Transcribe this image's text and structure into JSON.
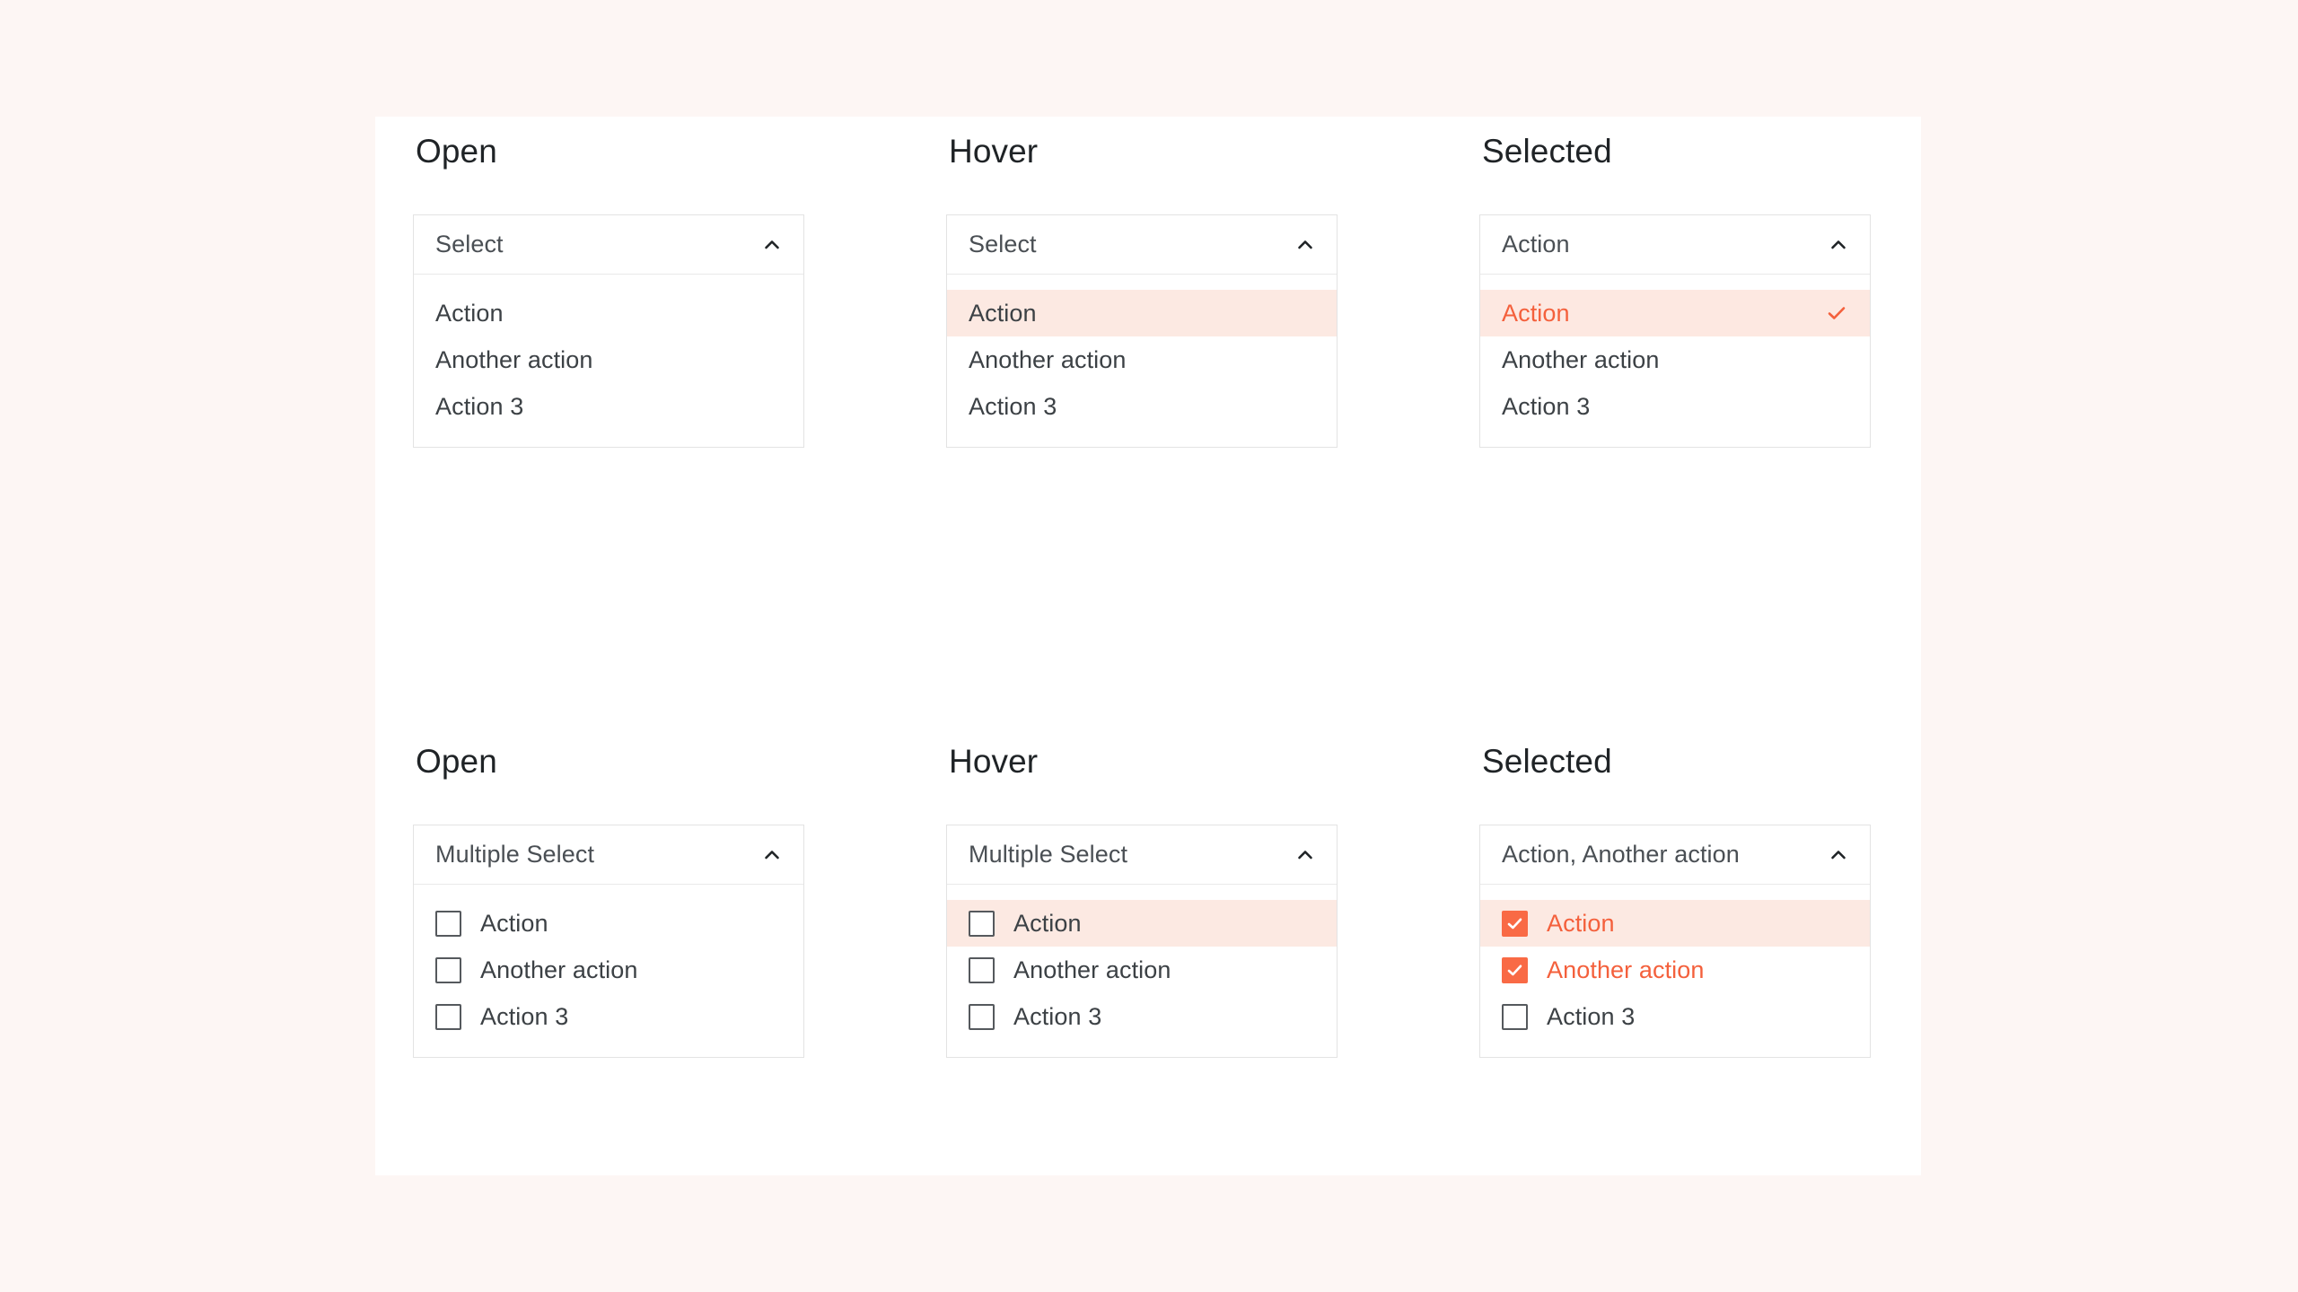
{
  "theme": {
    "page_background": "#FDF6F4",
    "card_background": "#FFFFFF",
    "accent": "#F4603C",
    "accent_checkbox": "#F96A45",
    "highlight_background": "#FCE9E2",
    "selected_background": "#FDE8E1",
    "border": "#E3E3E3",
    "text": "#3C4145",
    "title_text": "#1F2326"
  },
  "icons": {
    "chevron_up": "chevron-up-icon",
    "check": "check-icon",
    "checkbox": "checkbox-icon"
  },
  "sections": [
    {
      "id": "single-select",
      "columns": [
        {
          "id": "open",
          "title": "Open",
          "trigger_value": "Select",
          "chevron": "chevron-up-icon",
          "items": [
            {
              "label": "Action",
              "state": "default",
              "checkmark": false
            },
            {
              "label": "Another action",
              "state": "default",
              "checkmark": false
            },
            {
              "label": "Action 3",
              "state": "default",
              "checkmark": false
            }
          ]
        },
        {
          "id": "hover",
          "title": "Hover",
          "trigger_value": "Select",
          "chevron": "chevron-up-icon",
          "items": [
            {
              "label": "Action",
              "state": "hover",
              "checkmark": false
            },
            {
              "label": "Another action",
              "state": "default",
              "checkmark": false
            },
            {
              "label": "Action 3",
              "state": "default",
              "checkmark": false
            }
          ]
        },
        {
          "id": "selected",
          "title": "Selected",
          "trigger_value": "Action",
          "chevron": "chevron-up-icon",
          "items": [
            {
              "label": "Action",
              "state": "selected",
              "checkmark": true
            },
            {
              "label": "Another action",
              "state": "default",
              "checkmark": false
            },
            {
              "label": "Action 3",
              "state": "default",
              "checkmark": false
            }
          ]
        }
      ]
    },
    {
      "id": "multiple-select",
      "columns": [
        {
          "id": "open",
          "title": "Open",
          "trigger_value": "Multiple Select",
          "chevron": "chevron-up-icon",
          "items": [
            {
              "label": "Action",
              "state": "default",
              "checked": false
            },
            {
              "label": "Another action",
              "state": "default",
              "checked": false
            },
            {
              "label": "Action 3",
              "state": "default",
              "checked": false
            }
          ]
        },
        {
          "id": "hover",
          "title": "Hover",
          "trigger_value": "Multiple Select",
          "chevron": "chevron-up-icon",
          "items": [
            {
              "label": "Action",
              "state": "hover",
              "checked": false
            },
            {
              "label": "Another action",
              "state": "default",
              "checked": false
            },
            {
              "label": "Action 3",
              "state": "default",
              "checked": false
            }
          ]
        },
        {
          "id": "selected",
          "title": "Selected",
          "trigger_value": "Action, Another action",
          "chevron": "chevron-up-icon",
          "items": [
            {
              "label": "Action",
              "state": "hover",
              "checked": true
            },
            {
              "label": "Another action",
              "state": "default",
              "checked": true
            },
            {
              "label": "Action 3",
              "state": "default",
              "checked": false
            }
          ]
        }
      ]
    }
  ]
}
